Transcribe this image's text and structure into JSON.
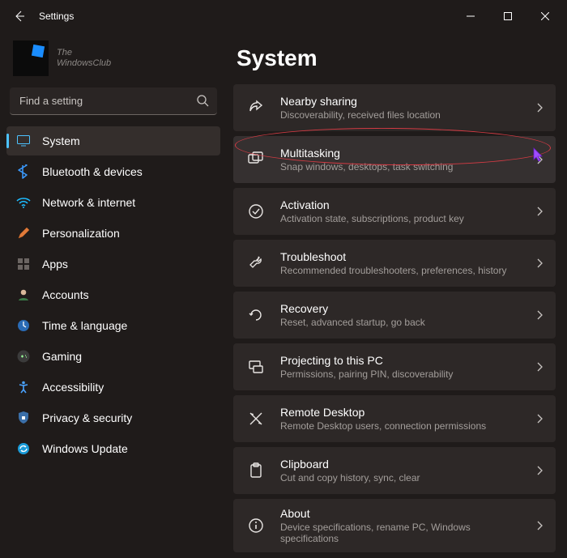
{
  "window": {
    "title": "Settings"
  },
  "watermark": {
    "line1": "The",
    "line2": "WindowsClub"
  },
  "search": {
    "placeholder": "Find a setting"
  },
  "nav": {
    "items": [
      {
        "label": "System"
      },
      {
        "label": "Bluetooth & devices"
      },
      {
        "label": "Network & internet"
      },
      {
        "label": "Personalization"
      },
      {
        "label": "Apps"
      },
      {
        "label": "Accounts"
      },
      {
        "label": "Time & language"
      },
      {
        "label": "Gaming"
      },
      {
        "label": "Accessibility"
      },
      {
        "label": "Privacy & security"
      },
      {
        "label": "Windows Update"
      }
    ]
  },
  "page": {
    "title": "System"
  },
  "cards": [
    {
      "title": "Nearby sharing",
      "sub": "Discoverability, received files location"
    },
    {
      "title": "Multitasking",
      "sub": "Snap windows, desktops, task switching"
    },
    {
      "title": "Activation",
      "sub": "Activation state, subscriptions, product key"
    },
    {
      "title": "Troubleshoot",
      "sub": "Recommended troubleshooters, preferences, history"
    },
    {
      "title": "Recovery",
      "sub": "Reset, advanced startup, go back"
    },
    {
      "title": "Projecting to this PC",
      "sub": "Permissions, pairing PIN, discoverability"
    },
    {
      "title": "Remote Desktop",
      "sub": "Remote Desktop users, connection permissions"
    },
    {
      "title": "Clipboard",
      "sub": "Cut and copy history, sync, clear"
    },
    {
      "title": "About",
      "sub": "Device specifications, rename PC, Windows specifications"
    }
  ]
}
